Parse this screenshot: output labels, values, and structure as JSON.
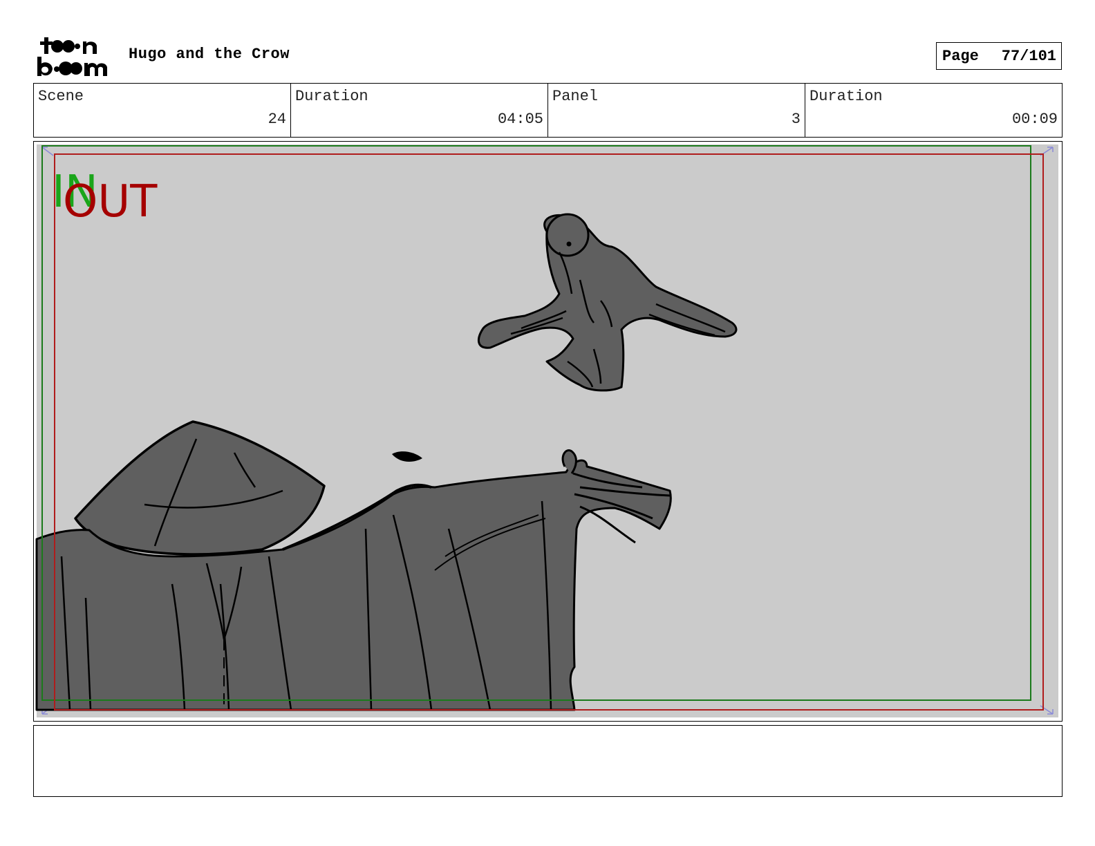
{
  "header": {
    "logo_text_top": "toon",
    "logo_text_bottom": "boom",
    "project_title": "Hugo and the Crow",
    "page_label": "Page",
    "page_number": "77/101"
  },
  "info": {
    "scene_label": "Scene",
    "scene_value": "24",
    "scene_duration_label": "Duration",
    "scene_duration_value": "04:05",
    "panel_label": "Panel",
    "panel_value": "3",
    "panel_duration_label": "Duration",
    "panel_duration_value": "00:09"
  },
  "panel": {
    "in_marker": "IN",
    "out_marker": "OUT",
    "in_color": "#1aa51a",
    "out_color": "#a50000",
    "background_color": "#cbcbcb",
    "fill_color": "#5f5f5f"
  },
  "notes": {
    "text": ""
  }
}
